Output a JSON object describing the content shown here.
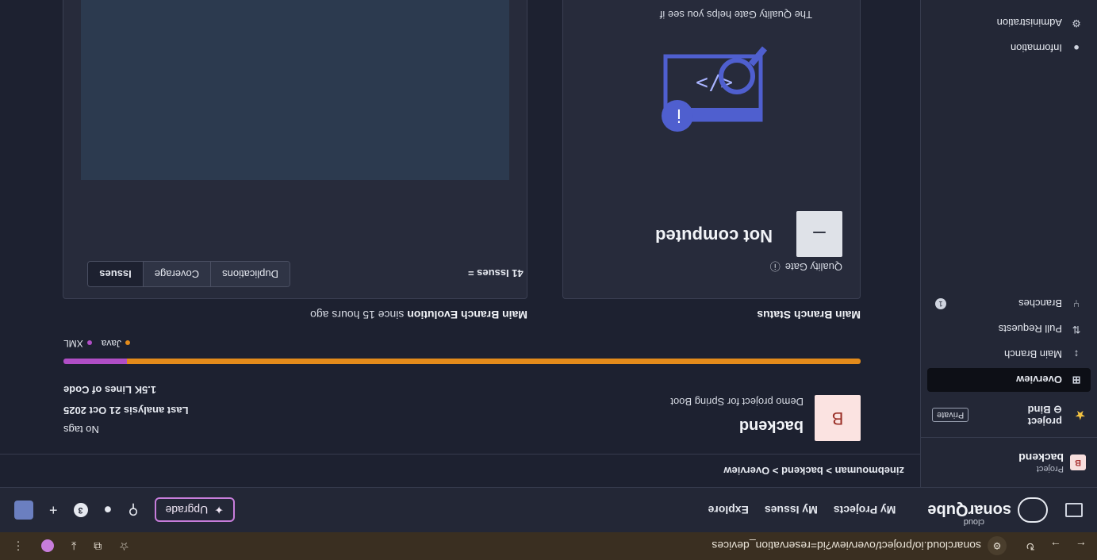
{
  "browser": {
    "url": "sonarcloud.io/project/overview?id=reservation_devices"
  },
  "topbar": {
    "brand": "sonarQube",
    "brand_sub": "cloud",
    "nav": [
      "My Projects",
      "My Issues",
      "Explore"
    ],
    "upgrade_label": "Upgrade",
    "notification_count": "3"
  },
  "sidebar": {
    "project_kind": "Project",
    "project_name": "backend",
    "project_initial": "B",
    "bind_label": "Bind",
    "bind_target": "project",
    "visibility": "Private",
    "items": [
      {
        "label": "Overview",
        "icon": "grid-icon"
      },
      {
        "label": "Main Branch",
        "icon": "branch-icon"
      },
      {
        "label": "Pull Requests",
        "icon": "pull-request-icon"
      },
      {
        "label": "Branches",
        "icon": "branches-icon",
        "count": "1"
      }
    ],
    "bottom_items": [
      {
        "label": "Information",
        "icon": "info-icon"
      },
      {
        "label": "Administration",
        "icon": "gear-icon"
      }
    ]
  },
  "breadcrumb": "zinebmouman > backend > Overview",
  "project": {
    "initial": "B",
    "name": "backend",
    "description": "Demo project for Spring Boot",
    "tags": "No tags",
    "last_analysis": "Last analysis 21 Oct 2025",
    "lines_of_code": "1.5K Lines of Code"
  },
  "languages": [
    {
      "name": "Java",
      "share": 0.92,
      "color": "#e38b1b"
    },
    {
      "name": "XML",
      "share": 0.08,
      "color": "#b04ec6"
    }
  ],
  "main_branch_status": {
    "title": "Main Branch Status",
    "quality_gate_label": "Quality Gate",
    "quality_gate_symbol": "–",
    "status": "Not computed",
    "help_text": "The Quality Gate helps you see if"
  },
  "main_branch_evolution": {
    "title": "Main Branch Evolution",
    "since": "since 15 hours ago",
    "tabs": [
      "Issues",
      "Coverage",
      "Duplications"
    ],
    "selected_tab": "Issues",
    "issues_count": "41 Issues ="
  }
}
